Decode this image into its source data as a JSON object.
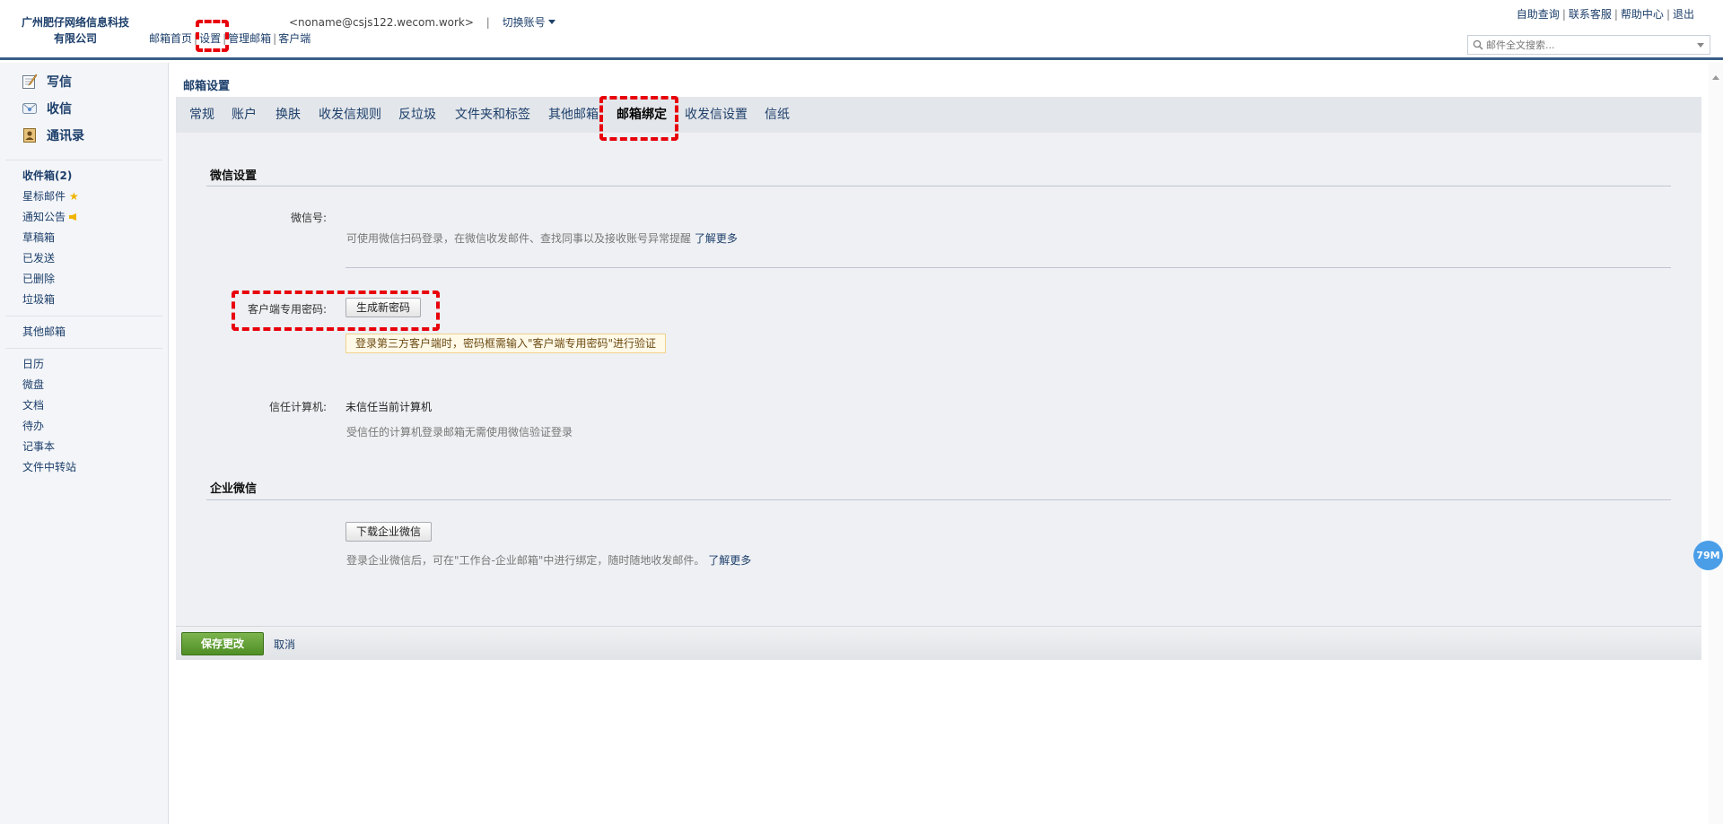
{
  "header": {
    "company_name": "广州肥仔网络信息科技有限公司",
    "account_email": "<noname@csjs122.wecom.work>",
    "switch_account": "切换账号",
    "nav": [
      "邮箱首页",
      "设置",
      "管理邮箱",
      "客户端"
    ],
    "top_links": [
      "自助查询",
      "联系客服",
      "帮助中心",
      "退出"
    ],
    "search_placeholder": "邮件全文搜索..."
  },
  "sidebar": {
    "main": [
      {
        "label": "写信",
        "icon": "compose-icon"
      },
      {
        "label": "收信",
        "icon": "inbox-icon"
      },
      {
        "label": "通讯录",
        "icon": "contacts-icon"
      }
    ],
    "folders": [
      "收件箱(2)",
      "星标邮件",
      "通知公告",
      "草稿箱",
      "已发送",
      "已删除",
      "垃圾箱"
    ],
    "other": "其他邮箱",
    "apps": [
      "日历",
      "微盘",
      "文档",
      "待办",
      "记事本",
      "文件中转站"
    ]
  },
  "main": {
    "page_title": "邮箱设置",
    "tabs": [
      "常规",
      "账户",
      "换肤",
      "收发信规则",
      "反垃圾",
      "文件夹和标签",
      "其他邮箱",
      "邮箱绑定",
      "收发信设置",
      "信纸"
    ],
    "active_tab": "邮箱绑定",
    "wechat": {
      "section_title": "微信设置",
      "wechat_label": "微信号:",
      "wechat_hint": "可使用微信扫码登录，在微信收发邮件、查找同事以及接收账号异常提醒",
      "learn_more": "了解更多",
      "client_pwd_label": "客户端专用密码:",
      "gen_pwd_button": "生成新密码",
      "pwd_warning": "登录第三方客户端时，密码框需输入\"客户端专用密码\"进行验证",
      "trusted_label": "信任计算机:",
      "trusted_value": "未信任当前计算机",
      "trusted_hint": "受信任的计算机登录邮箱无需使用微信验证登录"
    },
    "wework": {
      "section_title": "企业微信",
      "download_button": "下载企业微信",
      "hint": "登录企业微信后，可在\"工作台-企业邮箱\"中进行绑定，随时随地收发邮件。",
      "learn_more": "了解更多"
    },
    "footer": {
      "save": "保存更改",
      "cancel": "取消"
    }
  },
  "memory_badge": "79M"
}
